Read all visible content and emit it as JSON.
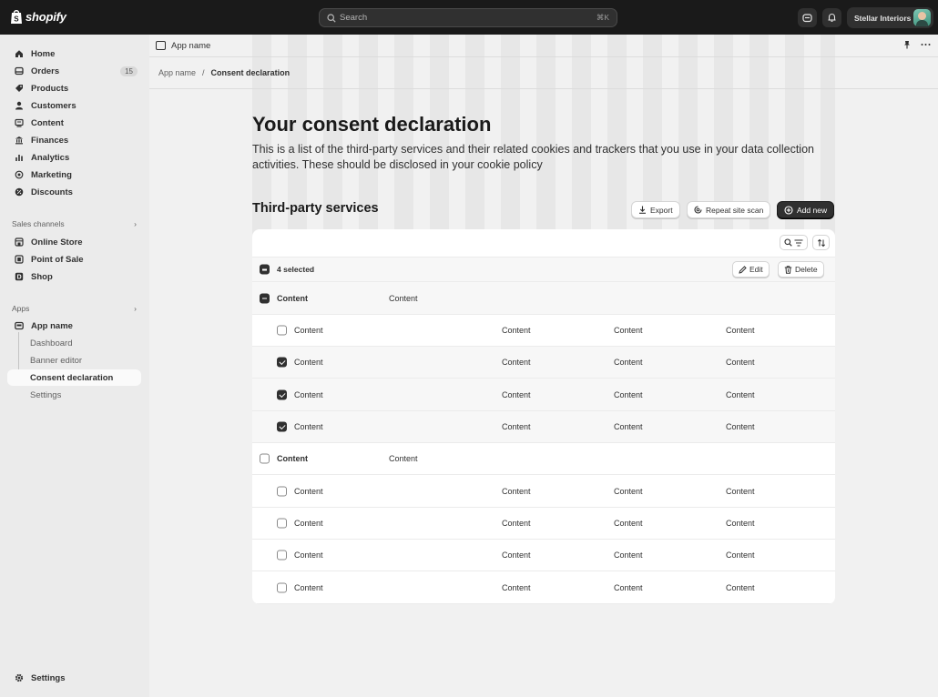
{
  "topbar": {
    "brand": "shopify",
    "search_placeholder": "Search",
    "search_shortcut": "⌘K",
    "store_name": "Stellar Interiors"
  },
  "sidebar": {
    "items": [
      {
        "label": "Home",
        "icon": "home-icon"
      },
      {
        "label": "Orders",
        "icon": "orders-icon",
        "badge": "15"
      },
      {
        "label": "Products",
        "icon": "tag-icon"
      },
      {
        "label": "Customers",
        "icon": "person-icon"
      },
      {
        "label": "Content",
        "icon": "content-icon"
      },
      {
        "label": "Finances",
        "icon": "bank-icon"
      },
      {
        "label": "Analytics",
        "icon": "bar-chart-icon"
      },
      {
        "label": "Marketing",
        "icon": "target-icon"
      },
      {
        "label": "Discounts",
        "icon": "discount-icon"
      }
    ],
    "sales_channels_label": "Sales channels",
    "sales_channels": [
      {
        "label": "Online Store",
        "icon": "store-icon"
      },
      {
        "label": "Point of Sale",
        "icon": "pos-icon"
      },
      {
        "label": "Shop",
        "icon": "shop-icon"
      }
    ],
    "apps_label": "Apps",
    "app": {
      "label": "App name",
      "icon": "app-icon"
    },
    "app_sub_items": [
      "Dashboard",
      "Banner editor",
      "Consent declaration",
      "Settings"
    ],
    "settings_label": "Settings"
  },
  "appbar": {
    "title": "App name"
  },
  "breadcrumb": {
    "parent": "App name",
    "separator": "/",
    "current": "Consent declaration"
  },
  "page": {
    "title": "Your consent declaration",
    "description": "This is a list of the third-party services and their related cookies and trackers that you use in your data collection activities. These should be disclosed in your cookie policy"
  },
  "section": {
    "title": "Third-party services",
    "export_label": "Export",
    "rescan_label": "Repeat site scan",
    "add_label": "Add new"
  },
  "table": {
    "selected_text": "4 selected",
    "edit_label": "Edit",
    "delete_label": "Delete",
    "rows": [
      {
        "kind": "group",
        "state": "mixed",
        "cells": [
          "Content",
          "Content"
        ]
      },
      {
        "kind": "item",
        "state": "off",
        "cells": [
          "Content",
          "Content",
          "Content",
          "Content"
        ]
      },
      {
        "kind": "item",
        "state": "on",
        "cells": [
          "Content",
          "Content",
          "Content",
          "Content"
        ]
      },
      {
        "kind": "item",
        "state": "on",
        "cells": [
          "Content",
          "Content",
          "Content",
          "Content"
        ]
      },
      {
        "kind": "item",
        "state": "on",
        "cells": [
          "Content",
          "Content",
          "Content",
          "Content"
        ]
      },
      {
        "kind": "group",
        "state": "off",
        "cells": [
          "Content",
          "Content"
        ]
      },
      {
        "kind": "item",
        "state": "off",
        "cells": [
          "Content",
          "Content",
          "Content",
          "Content"
        ]
      },
      {
        "kind": "item",
        "state": "off",
        "cells": [
          "Content",
          "Content",
          "Content",
          "Content"
        ]
      },
      {
        "kind": "item",
        "state": "off",
        "cells": [
          "Content",
          "Content",
          "Content",
          "Content"
        ]
      },
      {
        "kind": "item",
        "state": "off",
        "cells": [
          "Content",
          "Content",
          "Content",
          "Content"
        ]
      }
    ]
  }
}
